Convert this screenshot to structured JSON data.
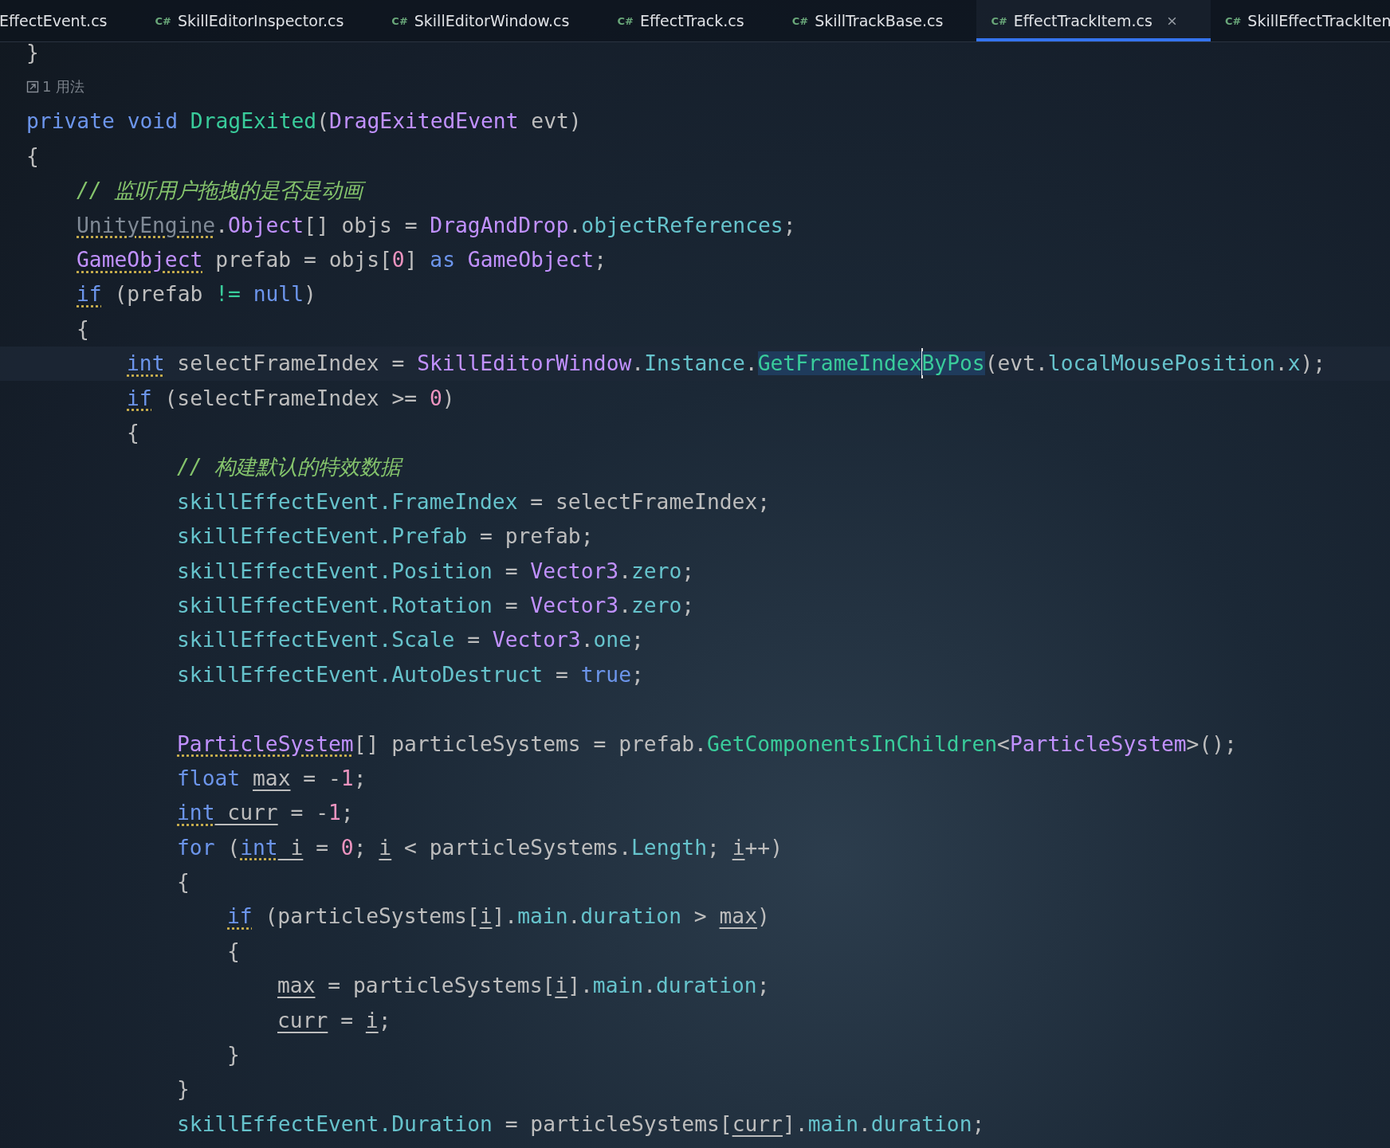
{
  "tabs": [
    {
      "label": "EffectEvent.cs",
      "selected": false
    },
    {
      "icon": "C#",
      "label": "SkillEditorInspector.cs",
      "selected": false
    },
    {
      "icon": "C#",
      "label": "SkillEditorWindow.cs",
      "selected": false
    },
    {
      "icon": "C#",
      "label": "EffectTrack.cs",
      "selected": false
    },
    {
      "icon": "C#",
      "label": "SkillTrackBase.cs",
      "selected": false
    },
    {
      "icon": "C#",
      "label": "EffectTrackItem.cs",
      "selected": true,
      "closable": true
    },
    {
      "icon": "C#",
      "label": "SkillEffectTrackIten",
      "selected": false
    }
  ],
  "lines": [
    {
      "kind": "code",
      "tokens": [
        {
          "text": "}",
          "kind": "plain"
        }
      ]
    },
    {
      "kind": "hint",
      "text": "1 用法"
    },
    {
      "kind": "code",
      "tokens": [
        {
          "text": "private",
          "kind": "keyword"
        },
        {
          "text": " void",
          "kind": "keyword"
        },
        {
          "text": " DragExited",
          "kind": "method"
        },
        {
          "text": "(",
          "kind": "plain"
        },
        {
          "text": "DragExitedEvent",
          "kind": "type"
        },
        {
          "text": " evt)",
          "kind": "plain"
        }
      ]
    },
    {
      "kind": "code",
      "tokens": [
        {
          "text": "{",
          "kind": "plain"
        }
      ],
      "children": [
        {
          "kind": "code",
          "tokens": [
            {
              "text": "// 监听用户拖拽的是否是动画",
              "kind": "comment"
            }
          ]
        },
        {
          "kind": "code",
          "tokens": [
            {
              "text": "UnityEngine",
              "kind": "namespace",
              "warning": true
            },
            {
              "text": ".",
              "kind": "plain"
            },
            {
              "text": "Object",
              "kind": "type"
            },
            {
              "text": "[] objs = ",
              "kind": "plain"
            },
            {
              "text": "DragAndDrop",
              "kind": "type"
            },
            {
              "text": ".",
              "kind": "plain"
            },
            {
              "text": "objectReferences",
              "kind": "field"
            },
            {
              "text": ";",
              "kind": "plain"
            }
          ]
        },
        {
          "kind": "code",
          "tokens": [
            {
              "text": "GameObject",
              "kind": "type",
              "warning": true
            },
            {
              "text": " prefab = objs[",
              "kind": "plain"
            },
            {
              "text": "0",
              "kind": "number"
            },
            {
              "text": "] ",
              "kind": "plain"
            },
            {
              "text": "as",
              "kind": "keyword"
            },
            {
              "text": " GameObject",
              "kind": "type"
            },
            {
              "text": ";",
              "kind": "plain"
            }
          ]
        },
        {
          "kind": "code",
          "tokens": [
            {
              "text": "if",
              "kind": "keyword",
              "warning": true
            },
            {
              "text": " (prefab ",
              "kind": "plain"
            },
            {
              "text": "!=",
              "kind": "operator"
            },
            {
              "text": " null",
              "kind": "keyword"
            },
            {
              "text": ")",
              "kind": "plain"
            }
          ]
        },
        {
          "kind": "code",
          "tokens": [
            {
              "text": "{",
              "kind": "plain"
            }
          ],
          "children": [
            {
              "kind": "code",
              "current": true,
              "tokens": [
                {
                  "text": "int",
                  "kind": "keyword",
                  "warning": true
                },
                {
                  "text": " selectFrameIndex = ",
                  "kind": "plain"
                },
                {
                  "text": "SkillEditorWindow",
                  "kind": "type"
                },
                {
                  "text": ".",
                  "kind": "plain"
                },
                {
                  "text": "Instance",
                  "kind": "field"
                },
                {
                  "text": ".",
                  "kind": "plain"
                },
                {
                  "text": "GetFrameIndex",
                  "kind": "method",
                  "highlighted": true,
                  "caret": true
                },
                {
                  "text": "ByPos",
                  "kind": "method",
                  "highlighted": true
                },
                {
                  "text": "(evt.",
                  "kind": "plain"
                },
                {
                  "text": "localMousePosition",
                  "kind": "field"
                },
                {
                  "text": ".",
                  "kind": "plain"
                },
                {
                  "text": "x",
                  "kind": "field"
                },
                {
                  "text": ");",
                  "kind": "plain"
                }
              ]
            },
            {
              "kind": "code",
              "tokens": [
                {
                  "text": "if",
                  "kind": "keyword",
                  "warning": true
                },
                {
                  "text": " (selectFrameIndex >= ",
                  "kind": "plain"
                },
                {
                  "text": "0",
                  "kind": "number"
                },
                {
                  "text": ")",
                  "kind": "plain"
                }
              ]
            },
            {
              "kind": "code",
              "tokens": [
                {
                  "text": "{",
                  "kind": "plain"
                }
              ],
              "children": [
                {
                  "kind": "code",
                  "tokens": [
                    {
                      "text": "// 构建默认的特效数据",
                      "kind": "comment"
                    }
                  ]
                },
                {
                  "kind": "code",
                  "tokens": [
                    {
                      "text": "skillEffectEvent.FrameIndex",
                      "kind": "field"
                    },
                    {
                      "text": " = selectFrameIndex;",
                      "kind": "plain"
                    }
                  ]
                },
                {
                  "kind": "code",
                  "tokens": [
                    {
                      "text": "skillEffectEvent.Prefab",
                      "kind": "field"
                    },
                    {
                      "text": " = prefab;",
                      "kind": "plain"
                    }
                  ]
                },
                {
                  "kind": "code",
                  "tokens": [
                    {
                      "text": "skillEffectEvent.Position",
                      "kind": "field"
                    },
                    {
                      "text": " = ",
                      "kind": "plain"
                    },
                    {
                      "text": "Vector3",
                      "kind": "type"
                    },
                    {
                      "text": ".",
                      "kind": "plain"
                    },
                    {
                      "text": "zero",
                      "kind": "field"
                    },
                    {
                      "text": ";",
                      "kind": "plain"
                    }
                  ]
                },
                {
                  "kind": "code",
                  "tokens": [
                    {
                      "text": "skillEffectEvent.Rotation",
                      "kind": "field"
                    },
                    {
                      "text": " = ",
                      "kind": "plain"
                    },
                    {
                      "text": "Vector3",
                      "kind": "type"
                    },
                    {
                      "text": ".",
                      "kind": "plain"
                    },
                    {
                      "text": "zero",
                      "kind": "field"
                    },
                    {
                      "text": ";",
                      "kind": "plain"
                    }
                  ]
                },
                {
                  "kind": "code",
                  "tokens": [
                    {
                      "text": "skillEffectEvent.Scale",
                      "kind": "field"
                    },
                    {
                      "text": " = ",
                      "kind": "plain"
                    },
                    {
                      "text": "Vector3",
                      "kind": "type"
                    },
                    {
                      "text": ".",
                      "kind": "plain"
                    },
                    {
                      "text": "one",
                      "kind": "field"
                    },
                    {
                      "text": ";",
                      "kind": "plain"
                    }
                  ]
                },
                {
                  "kind": "code",
                  "tokens": [
                    {
                      "text": "skillEffectEvent.AutoDestruct",
                      "kind": "field"
                    },
                    {
                      "text": " = ",
                      "kind": "plain"
                    },
                    {
                      "text": "true",
                      "kind": "keyword"
                    },
                    {
                      "text": ";",
                      "kind": "plain"
                    }
                  ]
                },
                {
                  "kind": "blank"
                },
                {
                  "kind": "code",
                  "tokens": [
                    {
                      "text": "ParticleSystem",
                      "kind": "type",
                      "warning": true
                    },
                    {
                      "text": "[] particleSystems = prefab.",
                      "kind": "plain"
                    },
                    {
                      "text": "GetComponentsInChildren",
                      "kind": "method"
                    },
                    {
                      "text": "<",
                      "kind": "plain"
                    },
                    {
                      "text": "ParticleSystem",
                      "kind": "type"
                    },
                    {
                      "text": ">();",
                      "kind": "plain"
                    }
                  ]
                },
                {
                  "kind": "code",
                  "tokens": [
                    {
                      "text": "float ",
                      "kind": "keyword"
                    },
                    {
                      "text": "max",
                      "kind": "plain",
                      "mutable": true
                    },
                    {
                      "text": " = -",
                      "kind": "plain"
                    },
                    {
                      "text": "1",
                      "kind": "number"
                    },
                    {
                      "text": ";",
                      "kind": "plain"
                    }
                  ]
                },
                {
                  "kind": "code",
                  "tokens": [
                    {
                      "text": "int",
                      "kind": "keyword",
                      "warning": true
                    },
                    {
                      "text": " curr",
                      "kind": "plain",
                      "mutable": true
                    },
                    {
                      "text": " = -",
                      "kind": "plain"
                    },
                    {
                      "text": "1",
                      "kind": "number"
                    },
                    {
                      "text": ";",
                      "kind": "plain"
                    }
                  ]
                },
                {
                  "kind": "code",
                  "tokens": [
                    {
                      "text": "for",
                      "kind": "keyword"
                    },
                    {
                      "text": " (",
                      "kind": "plain"
                    },
                    {
                      "text": "int",
                      "kind": "keyword",
                      "warning": true
                    },
                    {
                      "text": " i",
                      "kind": "plain",
                      "mutable": true
                    },
                    {
                      "text": " = ",
                      "kind": "plain"
                    },
                    {
                      "text": "0",
                      "kind": "number"
                    },
                    {
                      "text": "; ",
                      "kind": "plain"
                    },
                    {
                      "text": "i",
                      "kind": "plain",
                      "mutable": true
                    },
                    {
                      "text": " < particleSystems.",
                      "kind": "plain"
                    },
                    {
                      "text": "Length",
                      "kind": "field"
                    },
                    {
                      "text": "; ",
                      "kind": "plain"
                    },
                    {
                      "text": "i",
                      "kind": "plain",
                      "mutable": true
                    },
                    {
                      "text": "++)",
                      "kind": "plain"
                    }
                  ]
                },
                {
                  "kind": "code",
                  "tokens": [
                    {
                      "text": "{",
                      "kind": "plain"
                    }
                  ],
                  "children": [
                    {
                      "kind": "code",
                      "tokens": [
                        {
                          "text": "if",
                          "kind": "keyword",
                          "warning": true
                        },
                        {
                          "text": " (particleSystems[",
                          "kind": "plain"
                        },
                        {
                          "text": "i",
                          "kind": "plain",
                          "mutable": true
                        },
                        {
                          "text": "].",
                          "kind": "plain"
                        },
                        {
                          "text": "main",
                          "kind": "field"
                        },
                        {
                          "text": ".",
                          "kind": "plain"
                        },
                        {
                          "text": "duration",
                          "kind": "field"
                        },
                        {
                          "text": " > ",
                          "kind": "plain"
                        },
                        {
                          "text": "max",
                          "kind": "plain",
                          "mutable": true
                        },
                        {
                          "text": ")",
                          "kind": "plain"
                        }
                      ]
                    },
                    {
                      "kind": "code",
                      "tokens": [
                        {
                          "text": "{",
                          "kind": "plain"
                        }
                      ],
                      "children": [
                        {
                          "kind": "code",
                          "tokens": [
                            {
                              "text": "max",
                              "kind": "plain",
                              "mutable": true
                            },
                            {
                              "text": " = particleSystems[",
                              "kind": "plain"
                            },
                            {
                              "text": "i",
                              "kind": "plain",
                              "mutable": true
                            },
                            {
                              "text": "].",
                              "kind": "plain"
                            },
                            {
                              "text": "main",
                              "kind": "field"
                            },
                            {
                              "text": ".",
                              "kind": "plain"
                            },
                            {
                              "text": "duration",
                              "kind": "field"
                            },
                            {
                              "text": ";",
                              "kind": "plain"
                            }
                          ]
                        },
                        {
                          "kind": "code",
                          "tokens": [
                            {
                              "text": "curr",
                              "kind": "plain",
                              "mutable": true
                            },
                            {
                              "text": " = ",
                              "kind": "plain"
                            },
                            {
                              "text": "i",
                              "kind": "plain",
                              "mutable": true
                            },
                            {
                              "text": ";",
                              "kind": "plain"
                            }
                          ]
                        }
                      ]
                    },
                    {
                      "kind": "code",
                      "tokens": [
                        {
                          "text": "}",
                          "kind": "plain"
                        }
                      ]
                    }
                  ]
                },
                {
                  "kind": "code",
                  "tokens": [
                    {
                      "text": "}",
                      "kind": "plain"
                    }
                  ]
                },
                {
                  "kind": "code",
                  "tokens": [
                    {
                      "text": "skillEffectEvent.Duration",
                      "kind": "field"
                    },
                    {
                      "text": " = particleSystems[",
                      "kind": "plain"
                    },
                    {
                      "text": "curr",
                      "kind": "plain",
                      "mutable": true
                    },
                    {
                      "text": "].",
                      "kind": "plain"
                    },
                    {
                      "text": "main",
                      "kind": "field"
                    },
                    {
                      "text": ".",
                      "kind": "plain"
                    },
                    {
                      "text": "duration",
                      "kind": "field"
                    },
                    {
                      "text": ";",
                      "kind": "plain"
                    }
                  ]
                }
              ]
            }
          ]
        }
      ]
    }
  ]
}
